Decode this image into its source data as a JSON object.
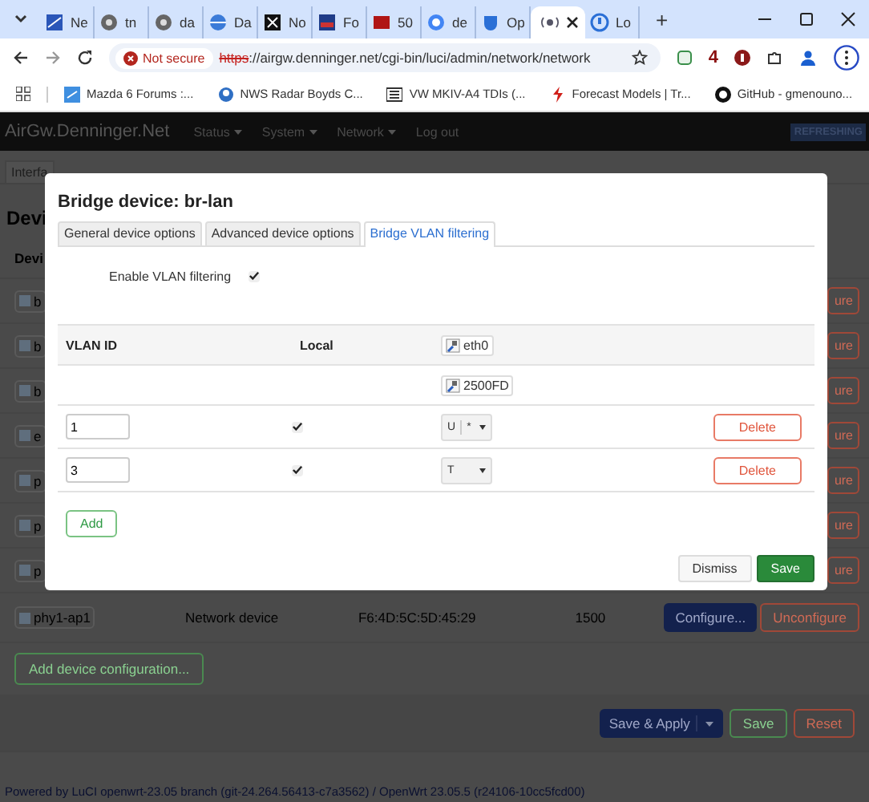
{
  "browser": {
    "tabs": [
      {
        "title": "Ne",
        "selected": false
      },
      {
        "title": "tn",
        "selected": false
      },
      {
        "title": "da",
        "selected": false
      },
      {
        "title": "Da",
        "selected": false
      },
      {
        "title": "No",
        "selected": false
      },
      {
        "title": "Fo",
        "selected": false
      },
      {
        "title": "50",
        "selected": false
      },
      {
        "title": "de",
        "selected": false
      },
      {
        "title": "Op",
        "selected": false
      },
      {
        "selected": true
      },
      {
        "title": "Lo",
        "selected": false
      }
    ],
    "new_tab": "+",
    "security": "Not secure",
    "url_scheme": "https",
    "url_rest": "://airgw.denninger.net/cgi-bin/luci/admin/network/network",
    "extension_badge": "4",
    "bookmarks": [
      "Mazda 6 Forums :...",
      "NWS Radar Boyds C...",
      "VW MKIV-A4 TDIs (...",
      "Forecast Models | Tr...",
      "GitHub - gmenouno..."
    ]
  },
  "header": {
    "brand": "AirGw.Denninger.Net",
    "menu": [
      "Status",
      "System",
      "Network",
      "Log out"
    ],
    "status_badge": "REFRESHING"
  },
  "page": {
    "tab": "Interfa",
    "heading": "Devi",
    "column_1": "Devi",
    "rows": [
      {
        "badge": "b",
        "button": "ure"
      },
      {
        "badge": "b",
        "button": "ure"
      },
      {
        "badge": "b",
        "button": "ure"
      },
      {
        "badge": "e",
        "button": "ure"
      },
      {
        "badge": "p",
        "button": "ure"
      },
      {
        "badge": "p",
        "button": "ure"
      },
      {
        "badge": "p",
        "button": "ure"
      }
    ],
    "device": {
      "name": "phy1-ap1",
      "type": "Network device",
      "mac": "F6:4D:5C:5D:45:29",
      "mtu": "1500",
      "configure": "Configure...",
      "unconfigure": "Unconfigure"
    },
    "add_button": "Add device configuration...",
    "actions": {
      "apply": "Save & Apply",
      "save": "Save",
      "reset": "Reset"
    },
    "footer": "Powered by LuCI openwrt-23.05 branch (git-24.264.56413-c7a3562) / OpenWrt 23.05.5 (r24106-10cc5fcd00)"
  },
  "dialog": {
    "title": "Bridge device: br-lan",
    "tabs": [
      {
        "label": "General device options",
        "selected": false
      },
      {
        "label": "Advanced device options",
        "selected": false
      },
      {
        "label": "Bridge VLAN filtering",
        "selected": true
      }
    ],
    "vlan_filtering": {
      "label": "Enable VLAN filtering",
      "checked": true
    },
    "columns": [
      "VLAN ID",
      "Local"
    ],
    "ports": [
      "eth0",
      "2500FD"
    ],
    "vlans": [
      {
        "id": "1",
        "local": true,
        "mode": "U",
        "flag": "*",
        "delete": "Delete"
      },
      {
        "id": "3",
        "local": true,
        "mode": "T",
        "delete": "Delete"
      }
    ],
    "add": "Add",
    "dismiss": "Dismiss",
    "save": "Save"
  }
}
